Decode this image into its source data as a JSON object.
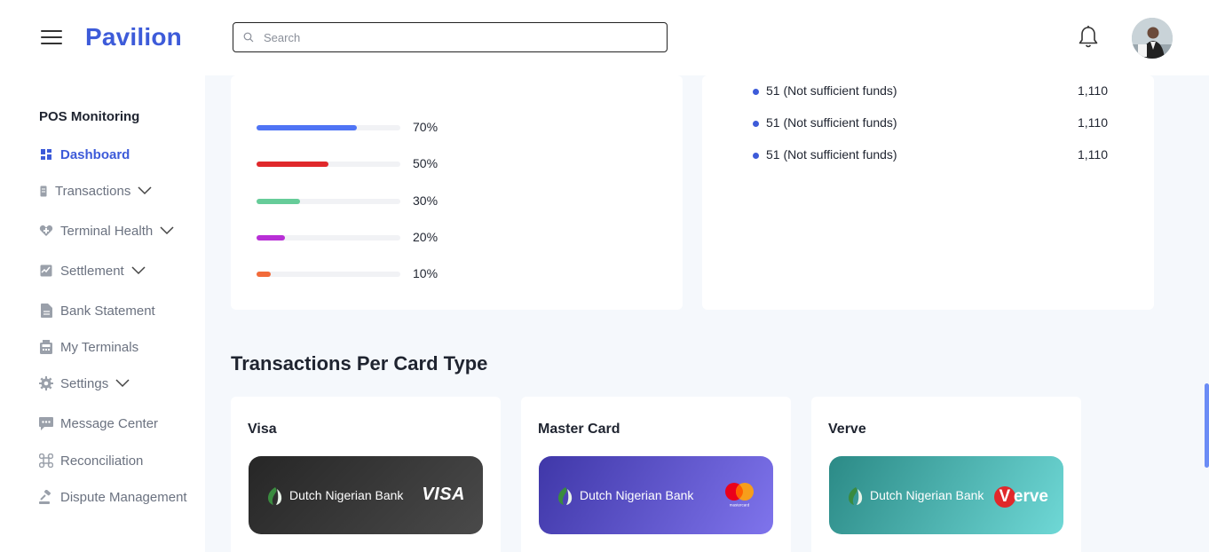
{
  "header": {
    "logo": "Pavilion",
    "search_placeholder": "Search"
  },
  "sidebar": {
    "section": "POS Monitoring",
    "items": [
      {
        "label": "Dashboard",
        "icon": "dashboard-icon",
        "active": true
      },
      {
        "label": "Transactions",
        "icon": "transactions-icon",
        "expandable": true
      },
      {
        "label": "Terminal Health",
        "icon": "heart-icon",
        "expandable": true
      },
      {
        "label": "Settlement",
        "icon": "settlement-icon",
        "expandable": true
      },
      {
        "label": "Bank Statement",
        "icon": "document-icon"
      },
      {
        "label": "My Terminals",
        "icon": "pos-terminal-icon"
      },
      {
        "label": "Settings",
        "icon": "gear-icon",
        "expandable": true
      },
      {
        "label": "Message Center",
        "icon": "message-icon"
      },
      {
        "label": "Reconciliation",
        "icon": "reconciliation-icon"
      },
      {
        "label": "Dispute Management",
        "icon": "gavel-icon"
      }
    ]
  },
  "progress_bars": [
    {
      "label": "70%",
      "value": 0.7,
      "color": "#4f74f5"
    },
    {
      "label": "50%",
      "value": 0.5,
      "color": "#e0282b"
    },
    {
      "label": "30%",
      "value": 0.3,
      "color": "#66cc99"
    },
    {
      "label": "20%",
      "value": 0.2,
      "color": "#b82fd6"
    },
    {
      "label": "10%",
      "value": 0.1,
      "color": "#f26b3a"
    }
  ],
  "failure_reasons": [
    {
      "reason": "51 (Not sufficient funds)",
      "count": "1,110"
    },
    {
      "reason": "51 (Not sufficient funds)",
      "count": "1,110"
    },
    {
      "reason": "51 (Not sufficient funds)",
      "count": "1,110"
    }
  ],
  "card_section": {
    "title": "Transactions Per Card Type",
    "cards": [
      {
        "name": "Visa",
        "bank": "Dutch Nigerian Bank",
        "brand": "VISA"
      },
      {
        "name": "Master Card",
        "bank": "Dutch Nigerian Bank",
        "brand": "mastercard"
      },
      {
        "name": "Verve",
        "bank": "Dutch Nigerian Bank",
        "brand_initial": "V",
        "brand_rest": "erve"
      }
    ]
  },
  "colors": {
    "accent": "#3d5bd9",
    "background": "#f5f8fc"
  }
}
